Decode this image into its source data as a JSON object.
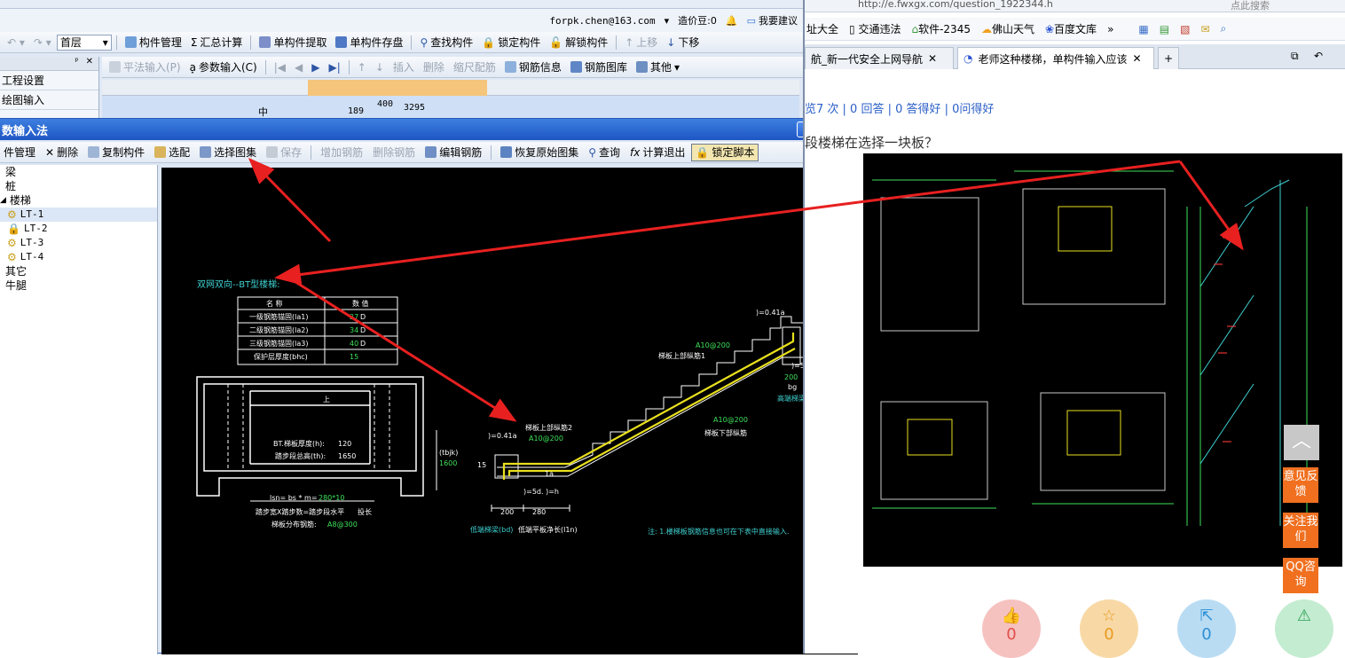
{
  "left_app": {
    "account": {
      "email": "forpk.chen@163.com",
      "beans": "造价豆:0",
      "suggest": "我要建议"
    },
    "toolbar1": {
      "floor": "首层",
      "items": [
        "构件管理",
        "汇总计算",
        "单构件提取",
        "单构件存盘",
        "查找构件",
        "锁定构件",
        "解锁构件",
        "上移",
        "下移"
      ]
    },
    "toolbar2": {
      "items": [
        "平法输入(P)",
        "参数输入(C)",
        "插入",
        "删除",
        "缩尺配筋",
        "钢筋信息",
        "钢筋图库",
        "其他"
      ]
    },
    "side_panel": {
      "items": [
        "工程设置",
        "绘图输入"
      ]
    },
    "grid": {
      "cell_text": "中",
      "values": [
        "189",
        "400",
        "3295"
      ]
    }
  },
  "dialog": {
    "title": "数输入法",
    "toolbar": [
      "件管理",
      "删除",
      "复制构件",
      "选配",
      "选择图集",
      "保存",
      "增加钢筋",
      "删除钢筋",
      "编辑钢筋",
      "恢复原始图集",
      "查询",
      "计算退出",
      "锁定脚本"
    ],
    "tree": {
      "items": [
        "梁",
        "桩",
        "楼梯",
        "LT-1",
        "LT-2",
        "LT-3",
        "LT-4",
        "其它",
        "牛腿"
      ]
    },
    "drawing": {
      "title": "双网双向--BT型楼梯:",
      "table_head": [
        "名 称",
        "数 值"
      ],
      "table_rows": [
        [
          "一级钢筋锚固(la1)",
          "27",
          "D"
        ],
        [
          "二级钢筋锚固(la2)",
          "34",
          "D"
        ],
        [
          "三级钢筋锚固(la3)",
          "40",
          "D"
        ],
        [
          "保护层厚度(bhc)",
          "15",
          ""
        ]
      ],
      "plan": {
        "bt": "BT.梯板厚度(h):",
        "bt_val": "120",
        "th": "踏步段总高(th):",
        "th_val": "1650",
        "up": "上",
        "ln": "lsn= bs * m=",
        "ln_val": "280*10",
        "caption": "踏步宽X踏步数=踏步段水平",
        "caption_box": "投长",
        "dist": "梯板分布钢筋:",
        "dist_val": "A8@300"
      },
      "labels": {
        "tbjk": "(tbjk)",
        "tbjk_val": "1600",
        "top_la": ")=0.41a",
        "top_rebar": "A10@200",
        "top_rebar_label": "梯板上部纵筋1",
        "d5": ")=5d. )=h",
        "bg": "bg",
        "bg_val": "200",
        "high_beam": "高端梯梁",
        "bot_rebar": "A10@200",
        "bot_rebar_label": "梯板下部纵筋",
        "up2_label": "梯板上部纵筋2",
        "up2_val": "A10@200",
        "la_low": ")=0.41a",
        "fifteen": "15",
        "la": "1a",
        "d5_low": ")=5d. )=h",
        "w1": "200",
        "w2": "280",
        "low_beam": "低端梯梁(bd)",
        "low_plate": "低端平板净长(l1n)",
        "note": "注: 1.楼梯板钢筋信息也可在下表中直接输入."
      }
    }
  },
  "browser": {
    "address": "http://e.fwxgx.com/question_1922344.h",
    "search": "点此搜索",
    "favorites": [
      "址大全",
      "交通违法",
      "软件-2345",
      "佛山天气",
      "百度文库"
    ],
    "tabs": [
      "航_新一代安全上网导航",
      "老师这种楼梯，单构件输入应该"
    ],
    "stats": "览7 次 | 0 回答 | 0 答得好 | 0问得好",
    "question": "段楼梯在选择一块板？",
    "side_buttons": [
      "意见反馈",
      "关注我们",
      "QQ咨询"
    ],
    "actions": [
      {
        "name": "like",
        "count": "0",
        "color": "#f6c2c0"
      },
      {
        "name": "favorite",
        "count": "0",
        "color": "#f8d9a6"
      },
      {
        "name": "share",
        "count": "0",
        "color": "#b9dcf3"
      },
      {
        "name": "report",
        "count": "",
        "color": "#c4ecd1"
      }
    ]
  }
}
